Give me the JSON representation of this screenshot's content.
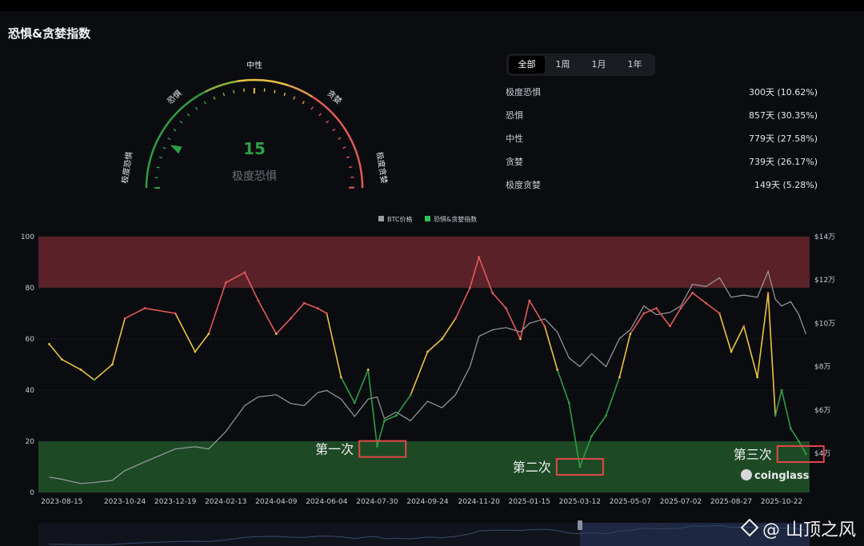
{
  "title": "恐惧&贪婪指数",
  "gauge": {
    "value": 15,
    "label": "极度恐惧",
    "zones": [
      "极度恐惧",
      "恐惧",
      "中性",
      "贪婪",
      "极度贪婪"
    ]
  },
  "tabs": [
    {
      "label": "全部",
      "active": true
    },
    {
      "label": "1周",
      "active": false
    },
    {
      "label": "1月",
      "active": false
    },
    {
      "label": "1年",
      "active": false
    }
  ],
  "stats": [
    {
      "label": "极度恐惧",
      "value": "300天 (10.62%)"
    },
    {
      "label": "恐惧",
      "value": "857天 (30.35%)"
    },
    {
      "label": "中性",
      "value": "779天 (27.58%)"
    },
    {
      "label": "贪婪",
      "value": "739天 (26.17%)"
    },
    {
      "label": "极度贪婪",
      "value": "149天 (5.28%)"
    }
  ],
  "colors": {
    "extreme_fear": "#2f9e44",
    "neutral": "#e8c340",
    "extreme_greed": "#e05a5a",
    "btc": "#9a9ca3",
    "greed_band": "#5a2228",
    "fear_band": "#1d4a25",
    "highlight": "#e04848"
  },
  "chart_data": {
    "type": "line",
    "legend": [
      "BTC价格",
      "恐惧&贪婪指数"
    ],
    "legend_position": "top-center",
    "x_ticks": [
      "2023-08-15",
      "2023-10-24",
      "2023-12-19",
      "2024-02-13",
      "2024-04-09",
      "2024-06-04",
      "2024-07-30",
      "2024-09-24",
      "2024-11-20",
      "2025-01-15",
      "2025-03-12",
      "2025-05-07",
      "2025-07-02",
      "2025-08-27",
      "2025-10-22"
    ],
    "y_left": {
      "range": [
        0,
        100
      ],
      "ticks": [
        0,
        20,
        40,
        60,
        80,
        100
      ]
    },
    "y_right": {
      "ticks": [
        "$4万",
        "$6万",
        "$8万",
        "$10万",
        "$12万",
        "$14万"
      ],
      "values": [
        40000,
        60000,
        80000,
        100000,
        120000,
        140000
      ]
    },
    "bands": [
      {
        "from": 80,
        "to": 100,
        "zone": "extreme_greed"
      },
      {
        "from": 0,
        "to": 20,
        "zone": "extreme_fear"
      }
    ],
    "series": [
      {
        "name": "恐惧&贪婪指数",
        "axis": "left",
        "x": [
          "2023-08-01",
          "2023-08-15",
          "2023-09-05",
          "2023-09-20",
          "2023-10-10",
          "2023-10-24",
          "2023-11-15",
          "2023-12-19",
          "2024-01-10",
          "2024-01-25",
          "2024-02-13",
          "2024-03-05",
          "2024-03-20",
          "2024-04-09",
          "2024-04-25",
          "2024-05-10",
          "2024-05-25",
          "2024-06-04",
          "2024-06-20",
          "2024-07-05",
          "2024-07-20",
          "2024-07-30",
          "2024-08-07",
          "2024-08-20",
          "2024-09-05",
          "2024-09-24",
          "2024-10-10",
          "2024-10-25",
          "2024-11-10",
          "2024-11-20",
          "2024-12-05",
          "2024-12-20",
          "2025-01-05",
          "2025-01-15",
          "2025-02-01",
          "2025-02-15",
          "2025-02-28",
          "2025-03-12",
          "2025-03-25",
          "2025-04-10",
          "2025-04-25",
          "2025-05-07",
          "2025-05-22",
          "2025-06-05",
          "2025-06-20",
          "2025-07-02",
          "2025-07-15",
          "2025-07-30",
          "2025-08-14",
          "2025-08-27",
          "2025-09-10",
          "2025-09-25",
          "2025-10-07",
          "2025-10-15",
          "2025-10-22",
          "2025-11-01",
          "2025-11-10",
          "2025-11-18"
        ],
        "values": [
          58,
          52,
          48,
          44,
          50,
          68,
          72,
          70,
          55,
          62,
          82,
          86,
          75,
          62,
          68,
          74,
          72,
          70,
          45,
          35,
          48,
          18,
          28,
          30,
          38,
          55,
          60,
          68,
          80,
          92,
          78,
          72,
          60,
          75,
          65,
          48,
          35,
          10,
          22,
          30,
          45,
          62,
          70,
          72,
          65,
          72,
          78,
          74,
          70,
          55,
          65,
          45,
          78,
          30,
          40,
          25,
          20,
          15
        ]
      },
      {
        "name": "BTC价格",
        "axis": "right",
        "x": [
          "2023-08-01",
          "2023-08-15",
          "2023-09-05",
          "2023-09-20",
          "2023-10-10",
          "2023-10-24",
          "2023-11-15",
          "2023-12-19",
          "2024-01-10",
          "2024-01-25",
          "2024-02-13",
          "2024-03-05",
          "2024-03-20",
          "2024-04-09",
          "2024-04-25",
          "2024-05-10",
          "2024-05-25",
          "2024-06-04",
          "2024-06-20",
          "2024-07-05",
          "2024-07-20",
          "2024-07-30",
          "2024-08-07",
          "2024-08-20",
          "2024-09-05",
          "2024-09-24",
          "2024-10-10",
          "2024-10-25",
          "2024-11-10",
          "2024-11-20",
          "2024-12-05",
          "2024-12-20",
          "2025-01-05",
          "2025-01-15",
          "2025-02-01",
          "2025-02-15",
          "2025-02-28",
          "2025-03-12",
          "2025-03-25",
          "2025-04-10",
          "2025-04-25",
          "2025-05-07",
          "2025-05-22",
          "2025-06-05",
          "2025-06-20",
          "2025-07-02",
          "2025-07-15",
          "2025-07-30",
          "2025-08-14",
          "2025-08-27",
          "2025-09-10",
          "2025-09-25",
          "2025-10-07",
          "2025-10-15",
          "2025-10-22",
          "2025-11-01",
          "2025-11-10",
          "2025-11-18"
        ],
        "values": [
          29000,
          28000,
          26000,
          26500,
          27500,
          32000,
          36000,
          42000,
          43000,
          42000,
          50000,
          62000,
          66000,
          67000,
          63000,
          62000,
          68000,
          69000,
          65000,
          57000,
          65000,
          66000,
          56000,
          59000,
          55000,
          64000,
          61000,
          67000,
          80000,
          94000,
          97000,
          98000,
          96000,
          100000,
          102000,
          96000,
          84000,
          80000,
          86000,
          80000,
          93000,
          97000,
          108000,
          104000,
          105000,
          108000,
          118000,
          117000,
          121000,
          112000,
          113000,
          112000,
          124000,
          111000,
          108000,
          110000,
          104000,
          95000
        ]
      }
    ],
    "annotations": [
      {
        "label": "第一次",
        "x": "2024-08-05",
        "y": 17
      },
      {
        "label": "第二次",
        "x": "2025-03-12",
        "y": 10
      },
      {
        "label": "第三次",
        "x": "2025-11-12",
        "y": 15
      }
    ],
    "brand": "coinglass"
  },
  "watermark": "@ 山顶之风"
}
